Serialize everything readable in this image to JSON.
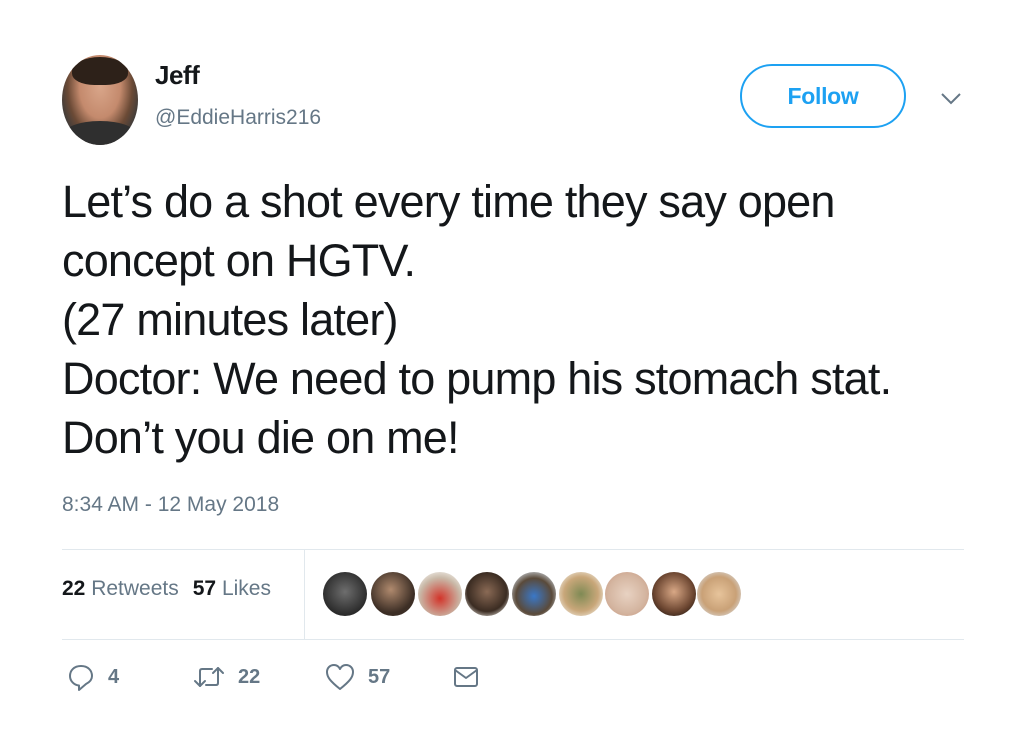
{
  "author": {
    "name": "Jeff",
    "handle": "@EddieHarris216"
  },
  "follow_label": "Follow",
  "tweet_lines": [
    "Let’s do a shot every time they say open",
    "concept on HGTV.",
    "(27 minutes later)",
    "Doctor: We need to pump his stomach stat.",
    "Don’t you die on me!"
  ],
  "timestamp": "8:34 AM - 12 May 2018",
  "stats": {
    "retweets_count": "22",
    "retweets_label": "Retweets",
    "likes_count": "57",
    "likes_label": "Likes"
  },
  "actions": {
    "reply_count": "4",
    "retweet_count": "22",
    "like_count": "57"
  },
  "icons": {
    "chevron": "chevron-down-icon",
    "reply": "reply-icon",
    "retweet": "retweet-icon",
    "like": "heart-icon",
    "message": "envelope-icon"
  },
  "colors": {
    "accent": "#1da1f2",
    "text": "#14171a",
    "secondary": "#657786",
    "divider": "#e1e8ed"
  }
}
